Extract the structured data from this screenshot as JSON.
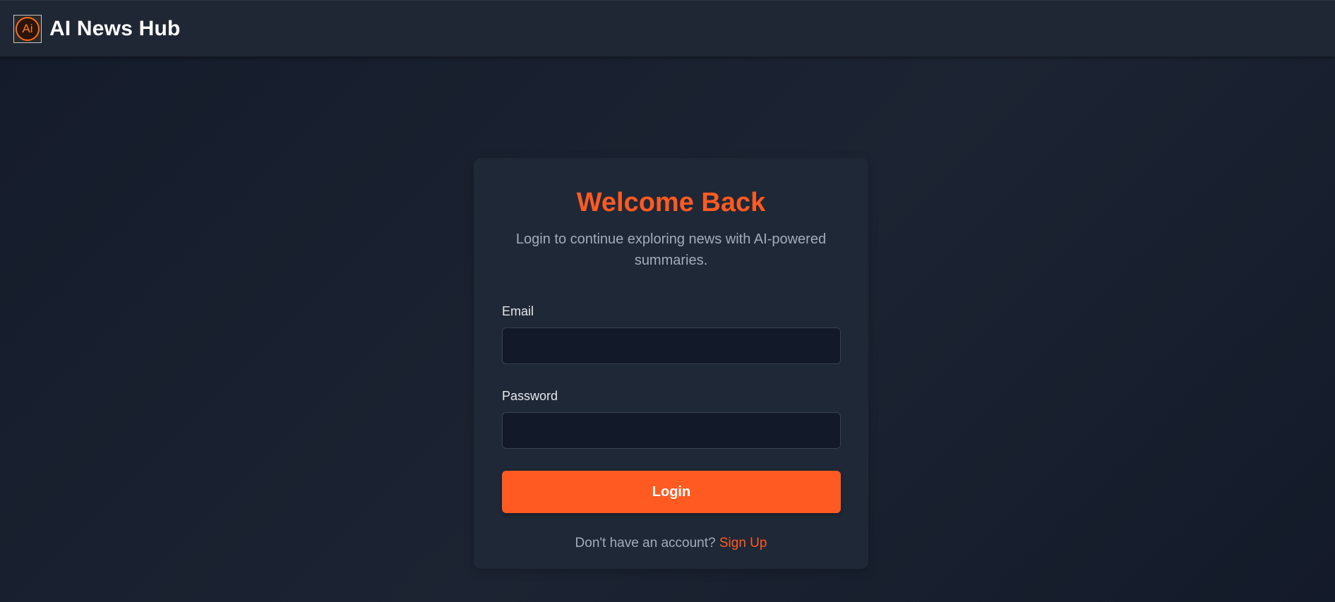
{
  "header": {
    "logo_text": "Ai",
    "brand": "AI News Hub"
  },
  "login_card": {
    "title": "Welcome Back",
    "subtitle": "Login to continue exploring news with AI-powered summaries.",
    "email_label": "Email",
    "email_value": "",
    "password_label": "Password",
    "password_value": "",
    "login_button": "Login",
    "signup_prompt": "Don't have an account?",
    "signup_link": "Sign Up"
  },
  "colors": {
    "accent": "#ff5a22",
    "background": "#141b2a",
    "card": "#1f2836",
    "navbar": "#1f2735"
  },
  "icons": {
    "logo": "adobe-illustrator-logo-icon"
  }
}
